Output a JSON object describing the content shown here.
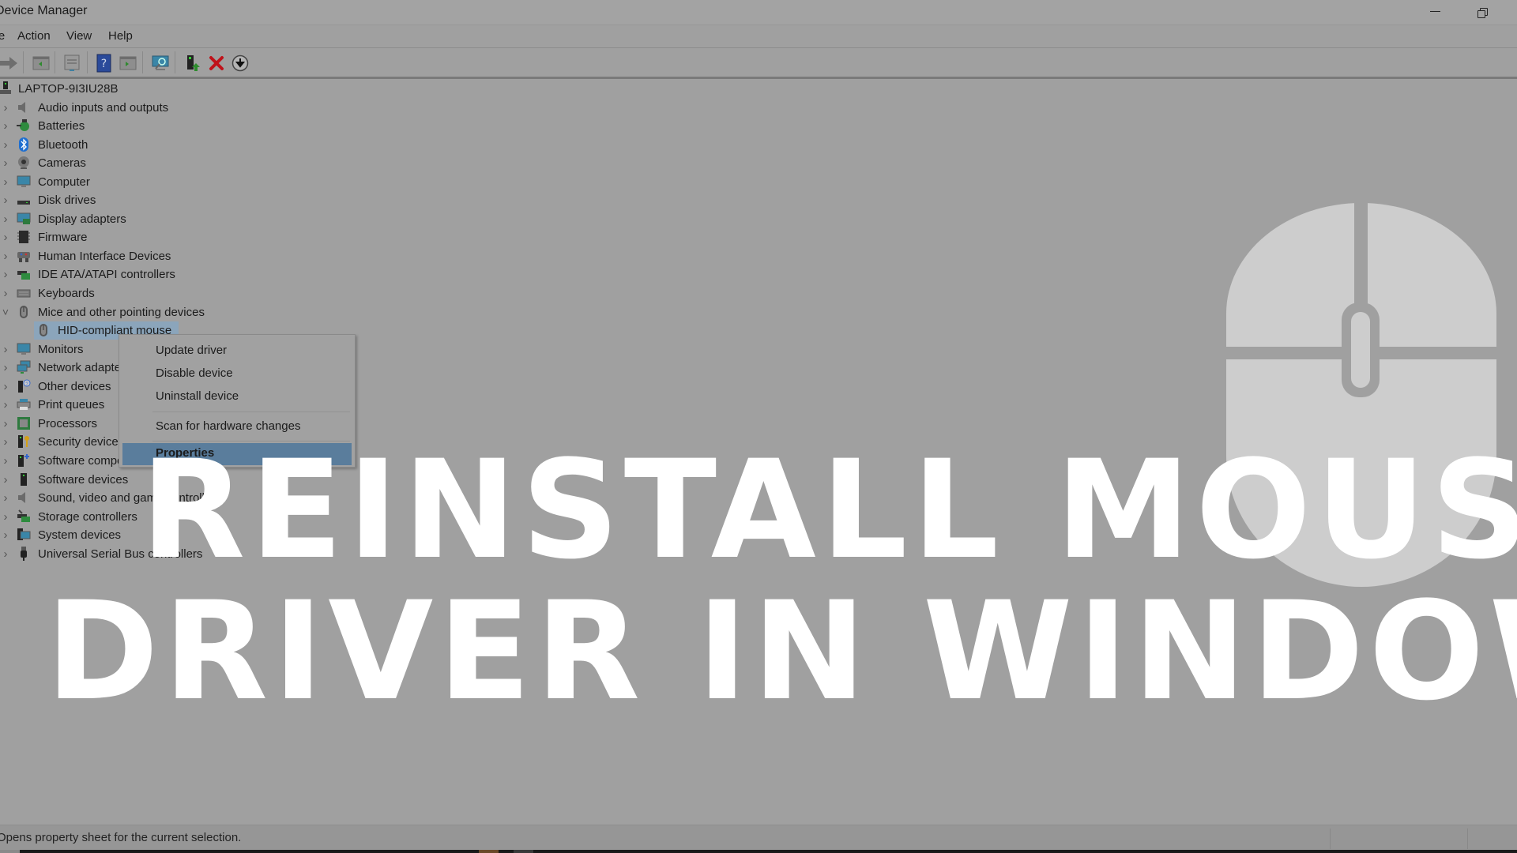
{
  "window": {
    "title": "Device Manager",
    "controls": {
      "minimize": "minimize-icon",
      "restore": "restore-icon"
    }
  },
  "menubar": {
    "items": [
      {
        "label": "File"
      },
      {
        "label": "Action"
      },
      {
        "label": "View"
      },
      {
        "label": "Help"
      }
    ]
  },
  "toolbar": {
    "buttons": [
      {
        "icon": "forward-arrow-icon",
        "label": "Forward"
      },
      {
        "icon": "show-hide-console-tree-icon",
        "label": "Show/Hide Console Tree"
      },
      {
        "icon": "properties-icon",
        "label": "Properties"
      },
      {
        "icon": "help-icon",
        "label": "Help"
      },
      {
        "icon": "show-action-pane-icon",
        "label": "Show/Hide Action Pane"
      },
      {
        "icon": "scan-hardware-icon",
        "label": "Scan for hardware changes"
      },
      {
        "icon": "update-driver-icon",
        "label": "Update driver"
      },
      {
        "icon": "uninstall-icon",
        "label": "Uninstall device"
      },
      {
        "icon": "disable-device-icon",
        "label": "Disable device"
      }
    ],
    "colors": {
      "help": "#2a4a9a",
      "uninstall": "#c0121a",
      "update": "#2e8b2e"
    }
  },
  "tree": {
    "root": {
      "label": "LAPTOP-9I3IU28B",
      "icon": "computer-root-icon"
    },
    "categories": [
      {
        "label": "Audio inputs and outputs",
        "icon": "speaker-icon",
        "expanded": false
      },
      {
        "label": "Batteries",
        "icon": "battery-icon",
        "expanded": false
      },
      {
        "label": "Bluetooth",
        "icon": "bluetooth-icon",
        "expanded": false
      },
      {
        "label": "Cameras",
        "icon": "camera-icon",
        "expanded": false
      },
      {
        "label": "Computer",
        "icon": "monitor-icon",
        "expanded": false
      },
      {
        "label": "Disk drives",
        "icon": "disk-drive-icon",
        "expanded": false
      },
      {
        "label": "Display adapters",
        "icon": "display-adapter-icon",
        "expanded": false
      },
      {
        "label": "Firmware",
        "icon": "chip-icon",
        "expanded": false
      },
      {
        "label": "Human Interface Devices",
        "icon": "hid-icon",
        "expanded": false
      },
      {
        "label": "IDE ATA/ATAPI controllers",
        "icon": "controller-card-icon",
        "expanded": false
      },
      {
        "label": "Keyboards",
        "icon": "keyboard-icon",
        "expanded": false
      },
      {
        "label": "Mice and other pointing devices",
        "icon": "mouse-icon",
        "expanded": true,
        "children": [
          {
            "label": "HID-compliant mouse",
            "icon": "mouse-icon",
            "selected": true
          }
        ]
      },
      {
        "label": "Monitors",
        "icon": "monitor-icon",
        "expanded": false
      },
      {
        "label": "Network adapters",
        "icon": "network-icon",
        "expanded": false
      },
      {
        "label": "Other devices",
        "icon": "unknown-device-icon",
        "expanded": false
      },
      {
        "label": "Print queues",
        "icon": "printer-icon",
        "expanded": false
      },
      {
        "label": "Processors",
        "icon": "processor-icon",
        "expanded": false
      },
      {
        "label": "Security devices",
        "icon": "security-key-icon",
        "expanded": false
      },
      {
        "label": "Software components",
        "icon": "software-component-icon",
        "expanded": false
      },
      {
        "label": "Software devices",
        "icon": "software-device-icon",
        "expanded": false
      },
      {
        "label": "Sound, video and game controllers",
        "icon": "speaker-icon",
        "expanded": false
      },
      {
        "label": "Storage controllers",
        "icon": "storage-controller-icon",
        "expanded": false
      },
      {
        "label": "System devices",
        "icon": "system-devices-icon",
        "expanded": false
      },
      {
        "label": "Universal Serial Bus controllers",
        "icon": "usb-icon",
        "expanded": false
      }
    ]
  },
  "context_menu": {
    "items": [
      {
        "label": "Update driver"
      },
      {
        "label": "Disable device"
      },
      {
        "label": "Uninstall device"
      },
      {
        "separator": true
      },
      {
        "label": "Scan for hardware changes"
      },
      {
        "separator": true
      },
      {
        "label": "Properties",
        "highlighted": true
      }
    ],
    "highlight_color": "#5a7d9c"
  },
  "statusbar": {
    "text": "Opens property sheet for the current selection."
  },
  "overlay": {
    "headline_line1": "REINSTALL MOUSE",
    "headline_line2": "DRIVER IN WINDOWS",
    "graphic_icon": "computer-mouse-icon",
    "text_color": "#ffffff",
    "graphic_color": "#cdcdcd"
  }
}
